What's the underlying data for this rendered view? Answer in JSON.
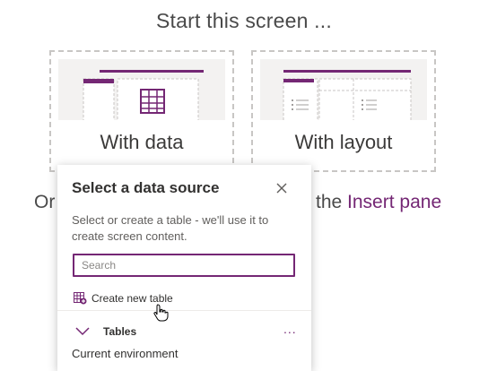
{
  "header": {
    "title": "Start this screen ..."
  },
  "options": [
    {
      "label": "With data"
    },
    {
      "label": "With layout"
    }
  ],
  "hint": {
    "prefix": "Or",
    "middle": "the",
    "link": "Insert pane"
  },
  "popup": {
    "title": "Select a data source",
    "description": "Select or create a table - we'll use it to create screen content.",
    "search_placeholder": "Search",
    "create_label": "Create new table",
    "section_label": "Tables",
    "more_label": "...",
    "environment_label": "Current environment"
  },
  "colors": {
    "accent": "#742774",
    "border": "#c8c6c4"
  },
  "icons": [
    "table-icon",
    "close-icon",
    "create-table-icon",
    "chevron-down-icon",
    "more-icon",
    "hand-cursor-icon"
  ]
}
